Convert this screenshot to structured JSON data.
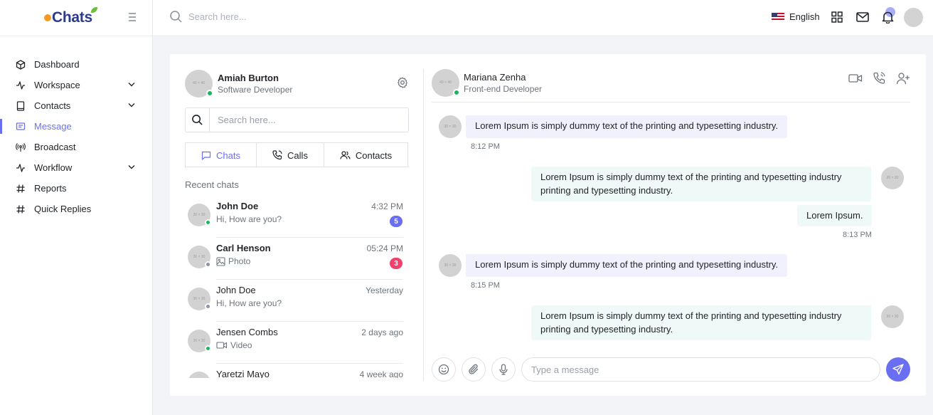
{
  "app": {
    "logo_text": "Chats"
  },
  "sidebar": {
    "items": [
      {
        "label": "Dashboard",
        "icon": "cube-icon",
        "has_chevron": false,
        "active": false
      },
      {
        "label": "Workspace",
        "icon": "activity-icon",
        "has_chevron": true,
        "active": false
      },
      {
        "label": "Contacts",
        "icon": "book-icon",
        "has_chevron": true,
        "active": false
      },
      {
        "label": "Message",
        "icon": "message-icon",
        "has_chevron": false,
        "active": true
      },
      {
        "label": "Broadcast",
        "icon": "broadcast-icon",
        "has_chevron": false,
        "active": false
      },
      {
        "label": "Workflow",
        "icon": "activity-icon",
        "has_chevron": true,
        "active": false
      },
      {
        "label": "Reports",
        "icon": "hash-icon",
        "has_chevron": false,
        "active": false
      },
      {
        "label": "Quick Replies",
        "icon": "hash-icon",
        "has_chevron": false,
        "active": false
      }
    ]
  },
  "topbar": {
    "search_placeholder": "Search here...",
    "language": "English",
    "icons": [
      "grid-icon",
      "mail-icon",
      "bell-icon"
    ]
  },
  "me": {
    "name": "Amiah Burton",
    "role": "Software Developer"
  },
  "chat_search": {
    "placeholder": "Search here..."
  },
  "tabs": [
    {
      "label": "Chats",
      "icon": "chat-icon"
    },
    {
      "label": "Calls",
      "icon": "phone-icon"
    },
    {
      "label": "Contacts",
      "icon": "users-icon"
    }
  ],
  "recent_label": "Recent chats",
  "chats": [
    {
      "name": "John Doe",
      "bold": true,
      "message": "Hi, How are you?",
      "message_icon": "",
      "time": "4:32 PM",
      "badge": "5",
      "badge_color": "#6a6ff2",
      "status": "online"
    },
    {
      "name": "Carl Henson",
      "bold": true,
      "message": "Photo",
      "message_icon": "image-icon",
      "time": "05:24 PM",
      "badge": "3",
      "badge_color": "#f1416c",
      "status": "offline"
    },
    {
      "name": "John Doe",
      "bold": false,
      "message": "Hi, How are you?",
      "message_icon": "",
      "time": "Yesterday",
      "badge": "",
      "badge_color": "",
      "status": "offline"
    },
    {
      "name": "Jensen Combs",
      "bold": false,
      "message": "Video",
      "message_icon": "video-icon",
      "time": "2 days ago",
      "badge": "",
      "badge_color": "",
      "status": "online"
    },
    {
      "name": "Yaretzi Mayo",
      "bold": false,
      "message": "",
      "message_icon": "",
      "time": "4 week ago",
      "badge": "",
      "badge_color": "",
      "status": "offline"
    }
  ],
  "conversation": {
    "name": "Mariana Zenha",
    "role": "Front-end Developer",
    "messages": [
      {
        "dir": "in",
        "texts": [
          "Lorem Ipsum is simply dummy text of the printing and typesetting industry."
        ],
        "time": "8:12 PM"
      },
      {
        "dir": "out",
        "texts": [
          "Lorem Ipsum is simply dummy text of the printing and typesetting industry printing and typesetting industry.",
          "Lorem Ipsum."
        ],
        "time": "8:13 PM"
      },
      {
        "dir": "in",
        "texts": [
          "Lorem Ipsum is simply dummy text of the printing and typesetting industry."
        ],
        "time": "8:15 PM"
      },
      {
        "dir": "out",
        "texts": [
          "Lorem Ipsum is simply dummy text of the printing and typesetting industry printing and typesetting industry."
        ],
        "time": ""
      }
    ],
    "composer_placeholder": "Type a message"
  },
  "colors": {
    "accent": "#6a6ff2",
    "online": "#1bb55c",
    "offline": "#8b93a7",
    "bubble_in": "#f1f1fd",
    "bubble_out": "#eef9f8"
  }
}
